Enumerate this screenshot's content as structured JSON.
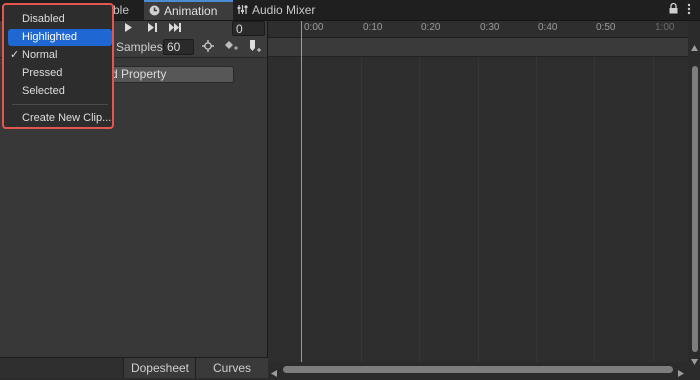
{
  "tabs": [
    {
      "label": "ble",
      "active": false
    },
    {
      "label": "Animation",
      "active": true,
      "icon": "clock-icon"
    },
    {
      "label": "Audio Mixer",
      "active": false,
      "icon": "mixer-sliders-icon"
    }
  ],
  "window_icons": [
    "lock-icon",
    "kebab-menu-icon"
  ],
  "toolbar": {
    "frame_value": "0",
    "samples_label": "Samples",
    "samples_value": "60"
  },
  "add_property_label": "d Property",
  "menu": {
    "items": [
      {
        "label": "Disabled",
        "checked": false,
        "highlighted": false
      },
      {
        "label": "Highlighted",
        "checked": false,
        "highlighted": true
      },
      {
        "label": "Normal",
        "checked": true,
        "highlighted": false
      },
      {
        "label": "Pressed",
        "checked": false,
        "highlighted": false
      },
      {
        "label": "Selected",
        "checked": false,
        "highlighted": false
      }
    ],
    "create_label": "Create New Clip...",
    "check_glyph": "✓"
  },
  "ruler": {
    "ticks": [
      "0:00",
      "0:10",
      "0:20",
      "0:30",
      "0:40",
      "0:50",
      "1:00"
    ]
  },
  "bottom_tabs": [
    "Dopesheet",
    "Curves"
  ],
  "colors": {
    "accent_highlight": "#1f67d2",
    "menu_border": "#e4574f",
    "active_tab_indicator": "#4a8bd4"
  }
}
